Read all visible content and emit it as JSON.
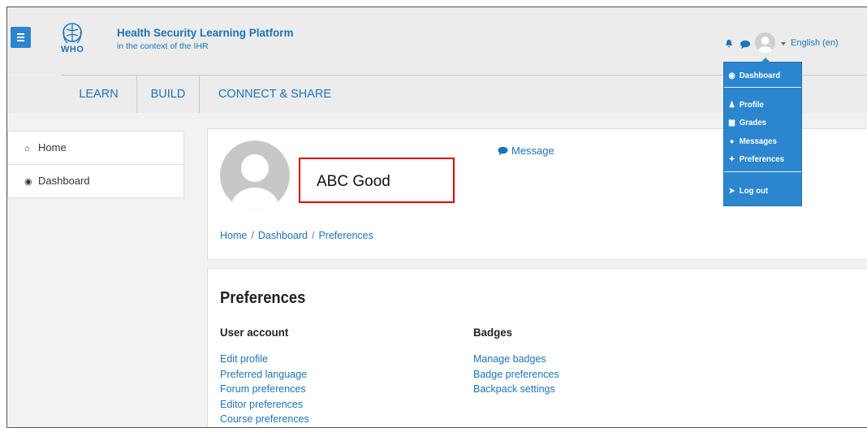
{
  "header": {
    "logo_text": "WHO",
    "title": "Health Security Learning Platform",
    "subtitle": "in the context of the IHR",
    "language": "English (en)"
  },
  "nav": {
    "items": [
      "LEARN",
      "BUILD",
      "CONNECT & SHARE"
    ]
  },
  "sidebar": {
    "items": [
      {
        "label": "Home",
        "icon": "home-icon"
      },
      {
        "label": "Dashboard",
        "icon": "dashboard-icon"
      }
    ]
  },
  "profile": {
    "name": "ABC Good",
    "message_label": "Message",
    "highlight_color": "#e00000"
  },
  "breadcrumb": {
    "items": [
      "Home",
      "Dashboard",
      "Preferences"
    ],
    "separator": "/"
  },
  "preferences": {
    "title": "Preferences",
    "user_account": {
      "heading": "User account",
      "links": [
        "Edit profile",
        "Preferred language",
        "Forum preferences",
        "Editor preferences",
        "Course preferences"
      ]
    },
    "badges": {
      "heading": "Badges",
      "links": [
        "Manage badges",
        "Badge preferences",
        "Backpack settings"
      ]
    }
  },
  "user_menu": {
    "items": [
      {
        "label": "Dashboard",
        "icon": "dashboard-icon"
      },
      {
        "label": "Profile",
        "icon": "user-icon"
      },
      {
        "label": "Grades",
        "icon": "table-icon"
      },
      {
        "label": "Messages",
        "icon": "chat-icon"
      },
      {
        "label": "Preferences",
        "icon": "wrench-icon"
      },
      {
        "label": "Log out",
        "icon": "sign-out-icon"
      }
    ]
  },
  "colors": {
    "accent": "#2b86cf",
    "link": "#1b74bb",
    "header_bg": "#ececec"
  }
}
